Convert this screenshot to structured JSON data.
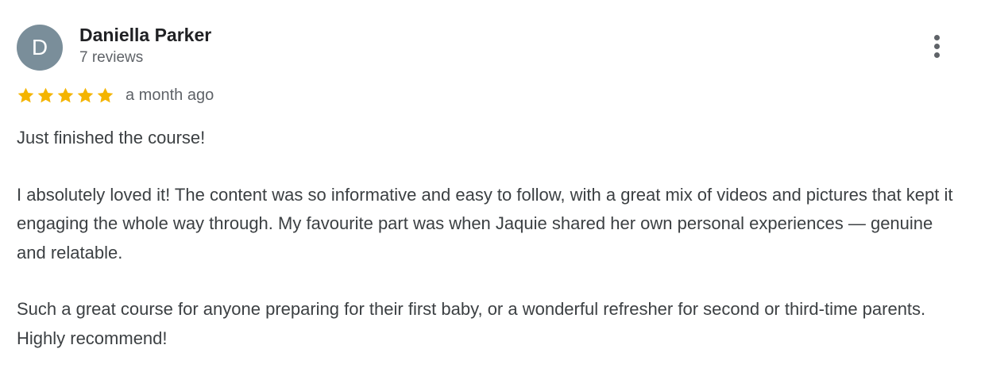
{
  "review": {
    "author": {
      "initial": "D",
      "name": "Daniella Parker",
      "review_count": "7 reviews",
      "avatar_color": "#7a8e9a"
    },
    "rating": {
      "stars": 5,
      "max_stars": 5,
      "star_color": "#f4b400",
      "timestamp": "a month ago"
    },
    "menu_icon": "more-vertical-icon",
    "paragraphs": [
      "Just finished the course!",
      "I absolutely loved it! The content was so informative and easy to follow, with a great mix of videos and pictures that kept it engaging the whole way through. My favourite part was when Jaquie shared her own personal experiences — genuine and relatable.",
      "Such a great course for anyone preparing for their first baby, or a wonderful refresher for second or third-time parents. Highly recommend!"
    ]
  }
}
